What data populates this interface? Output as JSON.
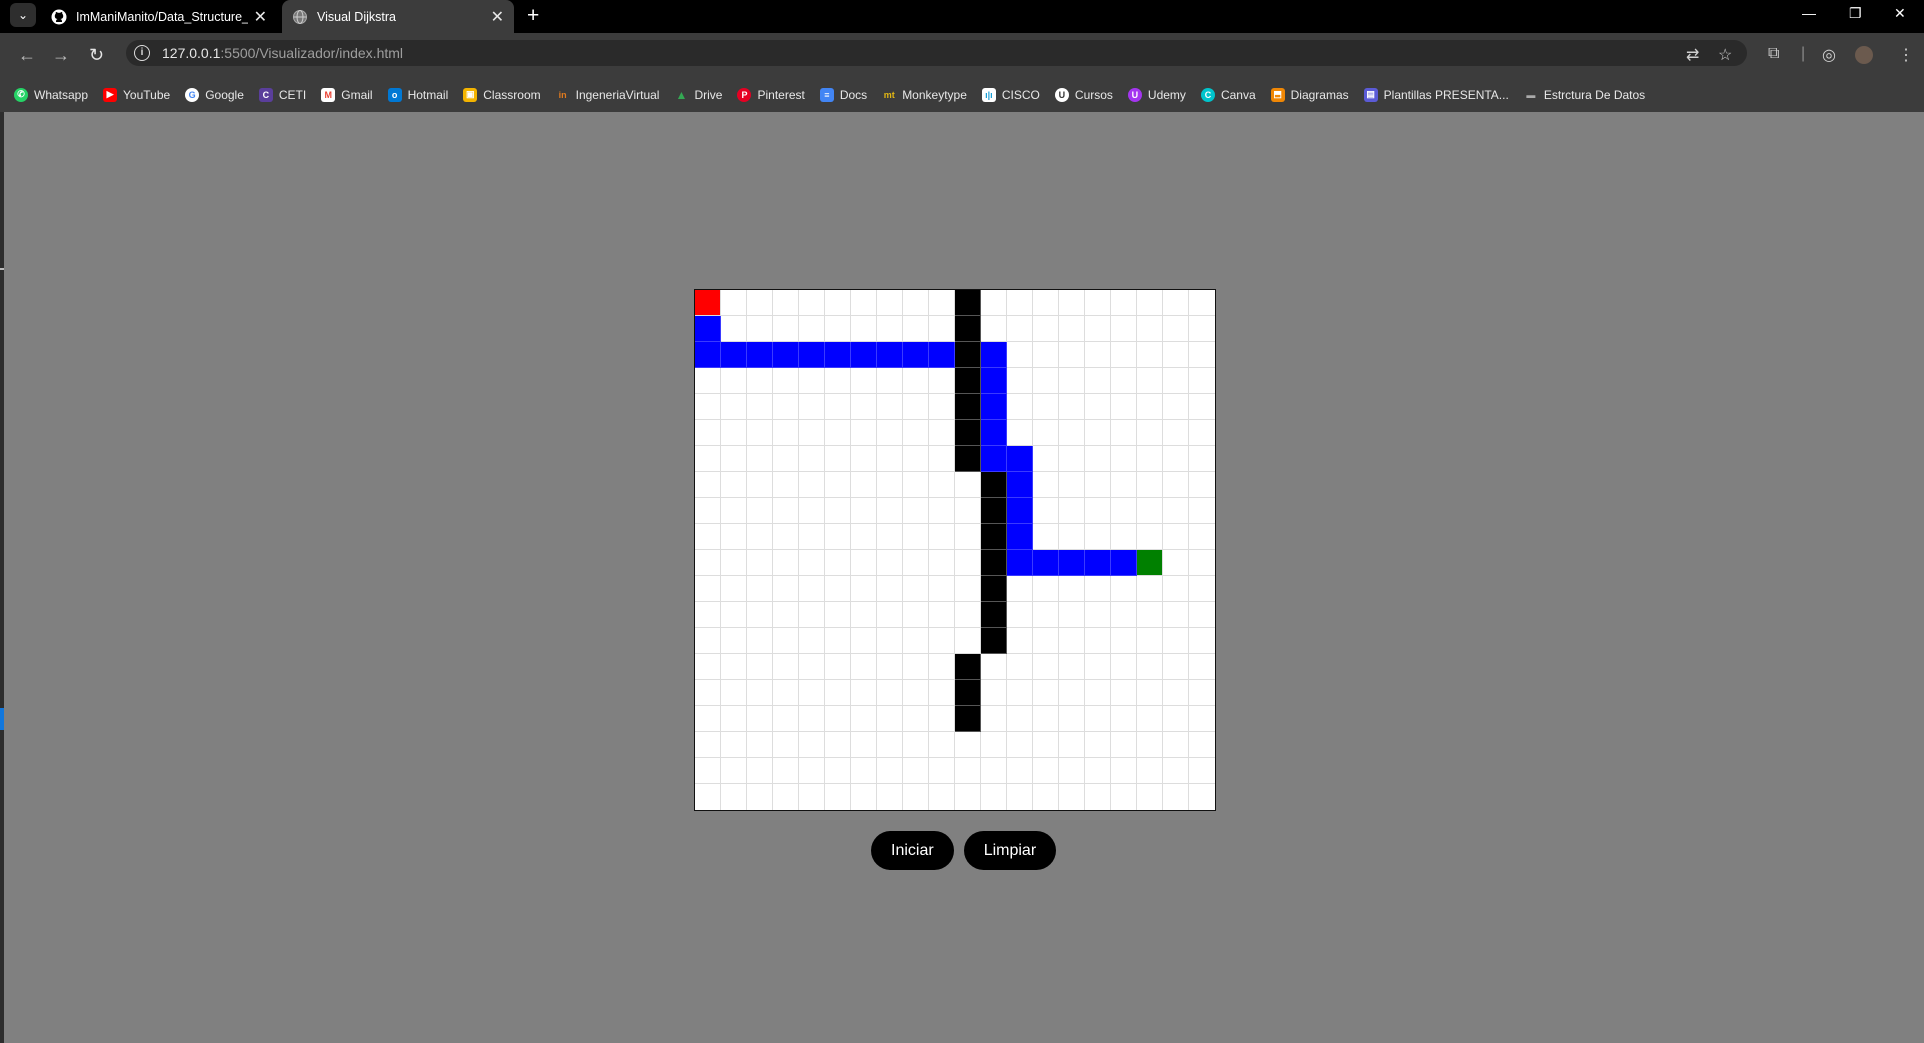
{
  "browser": {
    "tabs": [
      {
        "title": "ImManiManito/Data_Structure_",
        "icon": "github-icon",
        "active": false
      },
      {
        "title": "Visual Dijkstra",
        "icon": "globe-icon",
        "active": true
      }
    ],
    "url_host": "127.0.0.1",
    "url_path": ":5500/Visualizador/index.html",
    "bookmarks": [
      {
        "label": "Whatsapp",
        "icon": "whatsapp-icon",
        "color": "#25d366"
      },
      {
        "label": "YouTube",
        "icon": "youtube-icon",
        "color": "#ff0000"
      },
      {
        "label": "Google",
        "icon": "google-icon",
        "color": "#4285f4"
      },
      {
        "label": "CETI",
        "icon": "ceti-icon",
        "color": "#5a3e9b"
      },
      {
        "label": "Gmail",
        "icon": "gmail-icon",
        "color": "#ea4335"
      },
      {
        "label": "Hotmail",
        "icon": "outlook-icon",
        "color": "#0078d4"
      },
      {
        "label": "Classroom",
        "icon": "classroom-icon",
        "color": "#f4b400"
      },
      {
        "label": "IngeneriaVirtual",
        "icon": "ingeneria-icon",
        "color": "#e07a1f"
      },
      {
        "label": "Drive",
        "icon": "drive-icon",
        "color": "#34a853"
      },
      {
        "label": "Pinterest",
        "icon": "pinterest-icon",
        "color": "#e60023"
      },
      {
        "label": "Docs",
        "icon": "docs-icon",
        "color": "#4285f4"
      },
      {
        "label": "Monkeytype",
        "icon": "monkeytype-icon",
        "color": "#e2b714"
      },
      {
        "label": "CISCO",
        "icon": "cisco-icon",
        "color": "#1ba0d7"
      },
      {
        "label": "Cursos",
        "icon": "cursos-icon",
        "color": "#555555"
      },
      {
        "label": "Udemy",
        "icon": "udemy-icon",
        "color": "#a435f0"
      },
      {
        "label": "Canva",
        "icon": "canva-icon",
        "color": "#00c4cc"
      },
      {
        "label": "Diagramas",
        "icon": "diagramas-icon",
        "color": "#f08705"
      },
      {
        "label": "Plantillas PRESENTA...",
        "icon": "plantillas-icon",
        "color": "#5b5bd6"
      },
      {
        "label": "Estrctura De Datos",
        "icon": "folder-icon",
        "color": "#777777"
      }
    ]
  },
  "app": {
    "grid_size": 20,
    "colors": {
      "empty": "#ffffff",
      "wall": "#000000",
      "path": "#0000ff",
      "start": "#ff0000",
      "end": "#008000"
    },
    "start": [
      0,
      0
    ],
    "end": [
      10,
      17
    ],
    "walls": [
      [
        0,
        10
      ],
      [
        1,
        10
      ],
      [
        2,
        10
      ],
      [
        3,
        10
      ],
      [
        4,
        10
      ],
      [
        5,
        10
      ],
      [
        6,
        10
      ],
      [
        7,
        11
      ],
      [
        8,
        11
      ],
      [
        9,
        11
      ],
      [
        10,
        11
      ],
      [
        11,
        11
      ],
      [
        12,
        11
      ],
      [
        13,
        11
      ],
      [
        14,
        10
      ],
      [
        15,
        10
      ],
      [
        16,
        10
      ]
    ],
    "path": [
      [
        1,
        0
      ],
      [
        2,
        0
      ],
      [
        2,
        1
      ],
      [
        2,
        2
      ],
      [
        2,
        3
      ],
      [
        2,
        4
      ],
      [
        2,
        5
      ],
      [
        2,
        6
      ],
      [
        2,
        7
      ],
      [
        2,
        8
      ],
      [
        2,
        9
      ],
      [
        2,
        10
      ],
      [
        2,
        11
      ],
      [
        3,
        11
      ],
      [
        4,
        11
      ],
      [
        5,
        11
      ],
      [
        6,
        11
      ],
      [
        6,
        12
      ],
      [
        7,
        12
      ],
      [
        8,
        12
      ],
      [
        9,
        12
      ],
      [
        10,
        12
      ],
      [
        10,
        13
      ],
      [
        10,
        14
      ],
      [
        10,
        15
      ],
      [
        10,
        16
      ]
    ],
    "buttons": {
      "start": "Iniciar",
      "clear": "Limpiar"
    }
  }
}
